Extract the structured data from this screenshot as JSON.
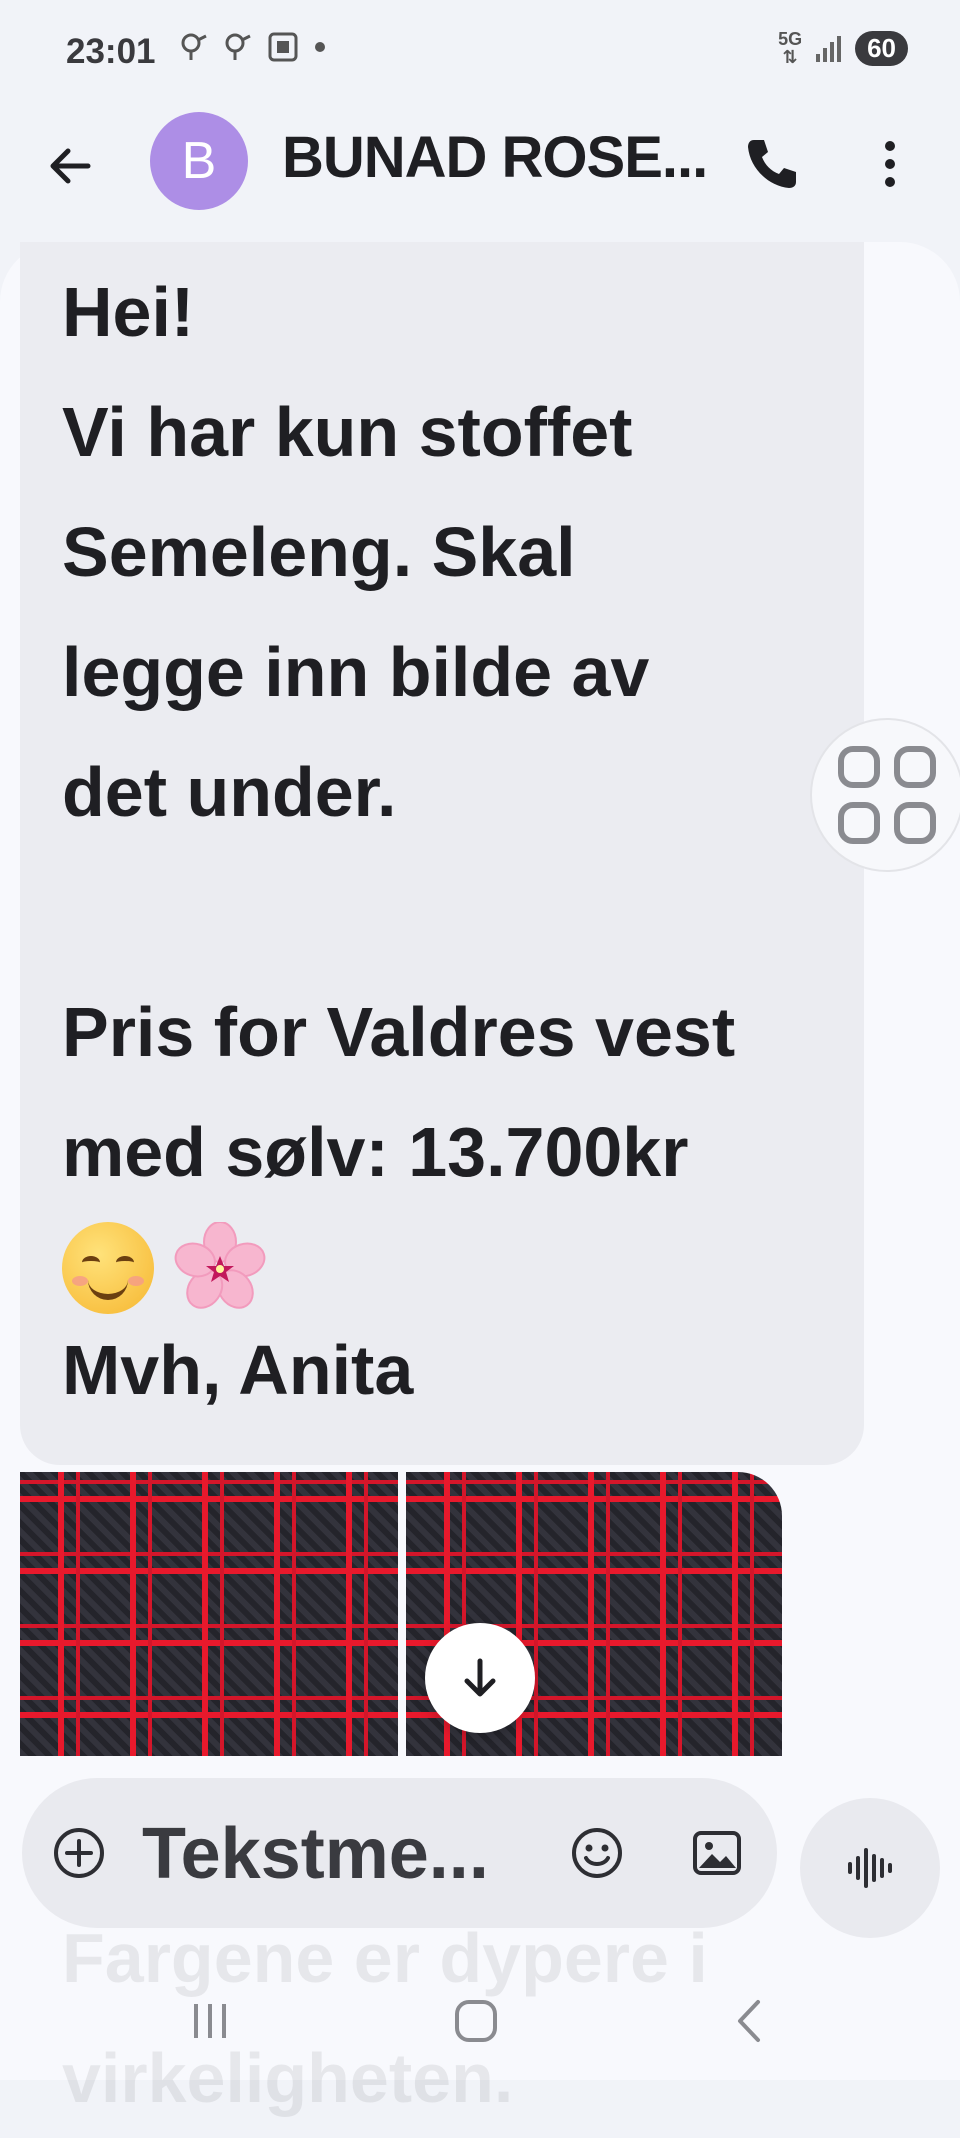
{
  "status": {
    "time": "23:01",
    "network": "5G",
    "battery": "60"
  },
  "header": {
    "avatar_letter": "B",
    "contact_name": "BUNAD ROSE..."
  },
  "message": {
    "body": "Hei!\nVi har kun stoffet\nSemeleng. Skal\nlegge inn bilde av\ndet under.\n\nPris for Valdres vest\nmed sølv: 13.700kr",
    "signature": "Mvh, Anita"
  },
  "next_message_partial": "Fargene er dypere i\nvirkeligheten.",
  "composer": {
    "placeholder": "Tekstme..."
  },
  "colors": {
    "accent": "#ad8ee6",
    "bubble": "#ebecf1",
    "background": "#f1f3f8"
  }
}
